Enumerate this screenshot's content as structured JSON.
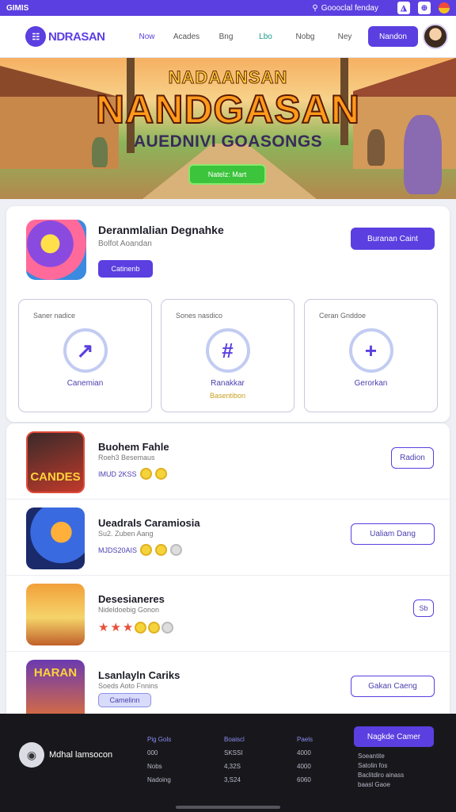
{
  "topbar": {
    "brand": "GIMIS",
    "search_text": "Goooclal fenday",
    "icons": [
      "search-icon",
      "notification-icon",
      "zoom-icon",
      "flag-icon"
    ]
  },
  "header": {
    "logo_text": "NDRASAN",
    "logo_mark": "☷",
    "nav": [
      "Now",
      "Acades",
      "Bng",
      "Lbo",
      "Nobg",
      "Ney"
    ],
    "cta_label": "Nandon"
  },
  "hero": {
    "title_top": "NADAANSAN",
    "title_main": "NANDGASAN",
    "title_sub": "AUEDNIVI GOASONGS",
    "button_label": "Natelz: Mart"
  },
  "featured": {
    "title": "Deranmlalian Degnahke",
    "subtitle": "Bolfot Aoandan",
    "tag_label": "Catinenb",
    "button_label": "Buranan Caint",
    "tiles": [
      {
        "label": "Saner nadice",
        "icon": "arrow-icon",
        "glyph": "↗",
        "caption": "Canemian",
        "note": ""
      },
      {
        "label": "Sones nasdico",
        "icon": "hash-icon",
        "glyph": "#",
        "caption": "Ranakkar",
        "note": "Basentibon"
      },
      {
        "label": "Ceran Gnddoe",
        "icon": "plus-icon",
        "glyph": "+",
        "caption": "Gerorkan",
        "note": ""
      }
    ]
  },
  "games": [
    {
      "title": "Buohem Fahle",
      "subtitle": "Roeh3 Besemaus",
      "meta": "IMUD 2KSS",
      "button": "Radion"
    },
    {
      "title": "Ueadrals Caramiosia",
      "subtitle": "Su2. Zuben Aang",
      "meta": "MJDS20AIS",
      "button": "Ualiam Dang"
    },
    {
      "title": "Desesianeres",
      "subtitle": "Nideldoebig Gonon",
      "meta": "",
      "button": "Sb"
    },
    {
      "title": "Lsanlayln Cariks",
      "subtitle": "Soeds Aoto Fnnins",
      "meta": "",
      "button": "Gakan Caeng",
      "pill": "Camelinn"
    }
  ],
  "game_thumb_text": [
    "CANDES",
    "",
    "",
    "HARAN"
  ],
  "footer": {
    "brand": "Mdhal lamsocon",
    "columns": [
      {
        "head": "Pig Gols",
        "items": [
          "000",
          "Nobs",
          "Nadoing"
        ]
      },
      {
        "head": "Boaiscl",
        "items": [
          "SKSSI",
          "4,32S",
          "3,S24"
        ]
      },
      {
        "head": "Paels",
        "items": [
          "4000",
          "4000",
          "6060"
        ]
      }
    ],
    "cta_label": "Nagkde Camer",
    "links": [
      "Soeantite",
      "Satolin fos",
      "Baclitdiro ainass",
      "baasl Gaoe"
    ]
  }
}
